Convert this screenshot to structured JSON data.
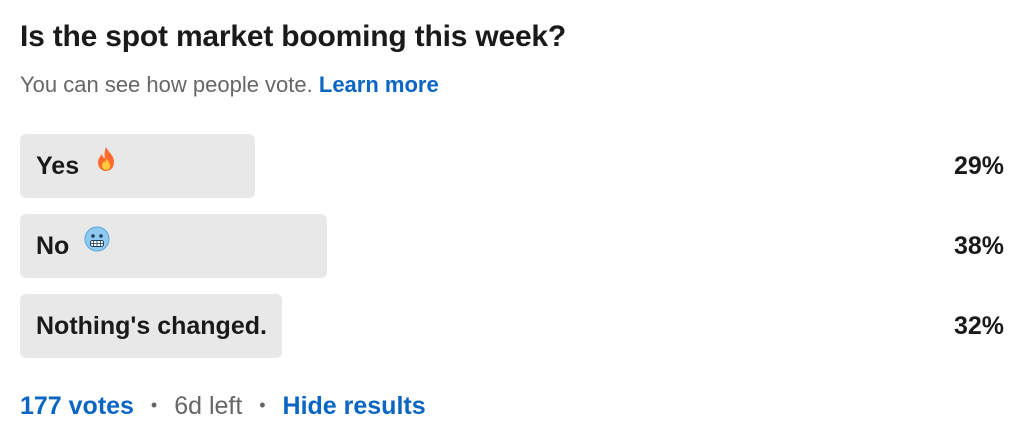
{
  "poll": {
    "question": "Is the spot market booming this week?",
    "visibility_text": "You can see how people vote.",
    "learn_more": "Learn more",
    "options": [
      {
        "label": "Yes",
        "emoji_icon": "fire-icon",
        "percent_text": "29%",
        "percent": 29
      },
      {
        "label": "No",
        "emoji_icon": "cold-face-icon",
        "percent_text": "38%",
        "percent": 38
      },
      {
        "label": "Nothing's changed.",
        "emoji_icon": "",
        "percent_text": "32%",
        "percent": 32
      }
    ],
    "footer": {
      "votes": "177 votes",
      "separator": "•",
      "time_left": "6d left",
      "hide_results": "Hide results"
    }
  },
  "colors": {
    "link": "#0a66c2",
    "bar": "#e8e8e8",
    "muted_text": "#666666",
    "fire_outer": "#ff6b2c",
    "fire_inner": "#ffc83d",
    "cold_face": "#8ec9ef"
  }
}
